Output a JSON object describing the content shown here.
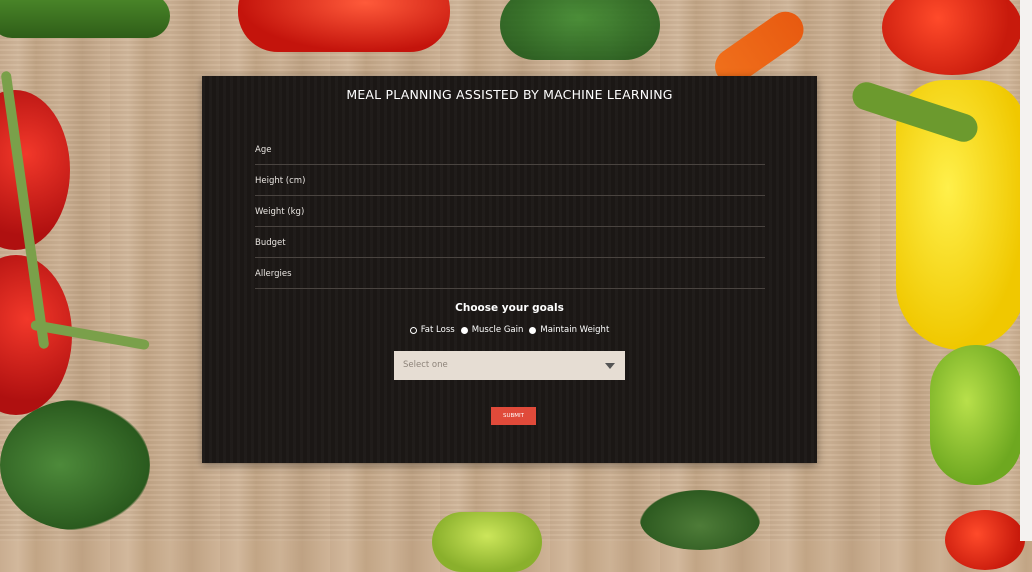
{
  "form": {
    "title": "MEAL PLANNING ASSISTED BY MACHINE LEARNING",
    "fields": [
      {
        "label": "Age"
      },
      {
        "label": "Height (cm)"
      },
      {
        "label": "Weight (kg)"
      },
      {
        "label": "Budget"
      },
      {
        "label": "Allergies"
      }
    ],
    "goals_title": "Choose your goals",
    "goals": [
      {
        "label": "Fat Loss",
        "selected": true
      },
      {
        "label": "Muscle Gain",
        "selected": false
      },
      {
        "label": "Maintain Weight",
        "selected": false
      }
    ],
    "select_placeholder": "Select one",
    "submit_label": "SUBMIT"
  },
  "colors": {
    "panel_bg": "#1c1816",
    "submit_bg": "#e04a3a",
    "select_bg": "#e6ddd3"
  }
}
